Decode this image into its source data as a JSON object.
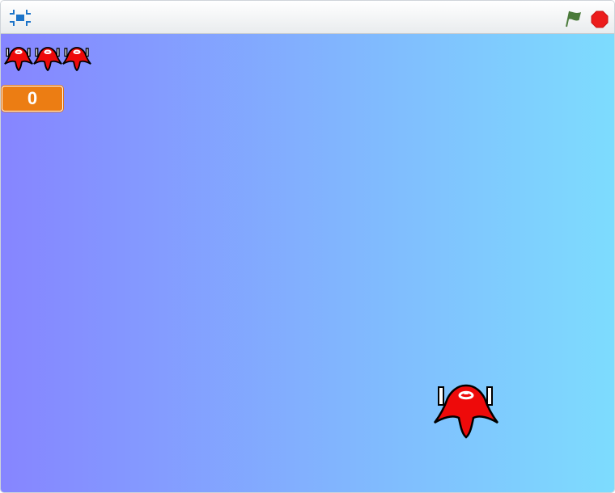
{
  "toolbar": {
    "fullscreen_icon": "fullscreen-icon",
    "green_flag_icon": "green-flag-icon",
    "stop_icon": "stop-sign-icon"
  },
  "stage": {
    "gradient_start": "#8685ff",
    "gradient_end": "#7ddcfe",
    "lives_remaining": 3,
    "score": "0"
  },
  "colors": {
    "score_badge": "#ec7d13",
    "flag": "#4a7a3a",
    "stop": "#ec1c1c",
    "ship_red": "#ee0a0a",
    "fullscreen_blue": "#1b73c9"
  }
}
